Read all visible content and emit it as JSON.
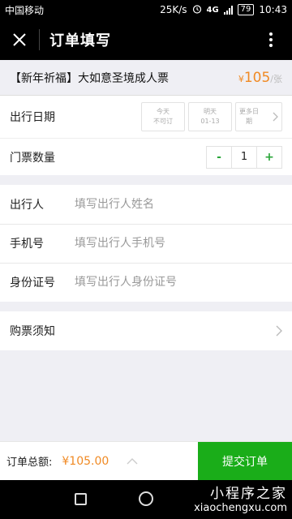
{
  "status_bar": {
    "carrier": "中国移动",
    "speed": "25K/s",
    "network": "4G",
    "battery": "79",
    "time": "10:43"
  },
  "header": {
    "title": "订单填写"
  },
  "ticket": {
    "name": "【新年祈福】大如意圣境成人票",
    "currency": "¥",
    "price": "105",
    "unit": "/张"
  },
  "date": {
    "label": "出行日期",
    "options": [
      {
        "line1": "今天",
        "line2": "不可订"
      },
      {
        "line1": "明天",
        "line2": "01-13"
      },
      {
        "line1": "更多日",
        "line2": "期"
      }
    ]
  },
  "quantity": {
    "label": "门票数量",
    "minus": "-",
    "value": "1",
    "plus": "+"
  },
  "form": {
    "traveler": {
      "label": "出行人",
      "placeholder": "填写出行人姓名"
    },
    "phone": {
      "label": "手机号",
      "placeholder": "填写出行人手机号"
    },
    "id_card": {
      "label": "身份证号",
      "placeholder": "填写出行人身份证号"
    }
  },
  "notice": {
    "label": "购票须知"
  },
  "footer": {
    "total_label": "订单总额:",
    "total_value": "¥105.00",
    "submit_label": "提交订单"
  },
  "watermark": {
    "cn": "小程序之家",
    "en": "xiaochengxu.com"
  },
  "colors": {
    "accent": "#f08a24",
    "primary": "#1aad19"
  }
}
